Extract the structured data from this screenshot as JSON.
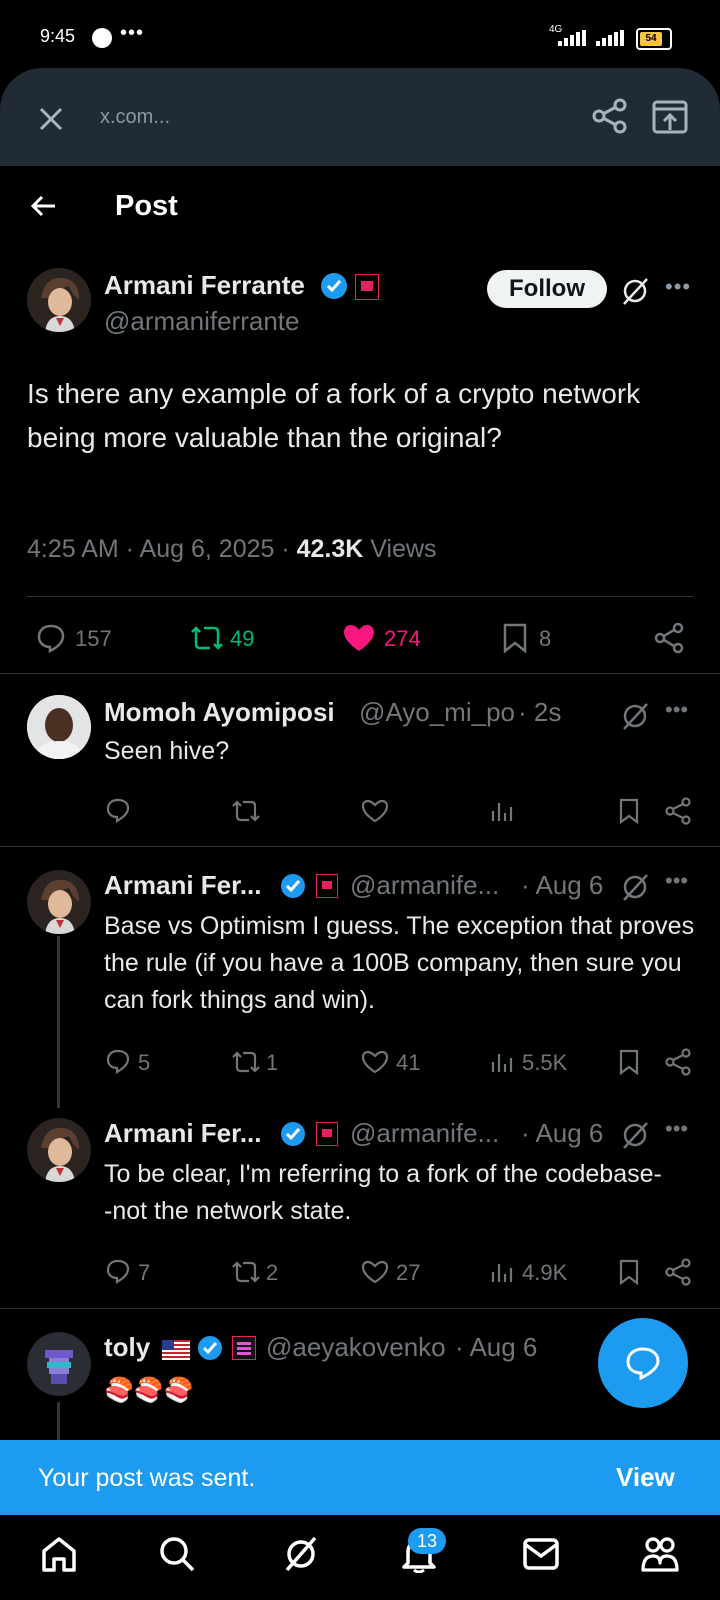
{
  "status_bar": {
    "time": "9:45",
    "network": "4G",
    "battery": "54"
  },
  "browser": {
    "url": "x.com..."
  },
  "header": {
    "title": "Post"
  },
  "post": {
    "author_name": "Armani Ferrante",
    "handle": "@armaniferrante",
    "follow_label": "Follow",
    "text": "Is there any example of a fork of a crypto network being more valuable than the original?",
    "time": "4:25 AM · Aug 6, 2025 · ",
    "views_count": "42.3K",
    "views_label": " Views",
    "stats": {
      "replies": "157",
      "reposts": "49",
      "likes": "274",
      "bookmarks": "8"
    }
  },
  "replies": [
    {
      "name": "Momoh Ayomiposi",
      "handle": "@Ayo_mi_po",
      "time": "· 2s",
      "text": "Seen hive?",
      "replies": "",
      "reposts": "",
      "likes": "",
      "views": ""
    },
    {
      "name": "Armani Fer...",
      "handle": "@armanife...",
      "time": "· Aug 6",
      "text": "Base vs Optimism I guess. The exception that proves the rule (if you have a 100B company, then sure you can fork things and win).",
      "replies": "5",
      "reposts": "1",
      "likes": "41",
      "views": "5.5K"
    },
    {
      "name": "Armani Fer...",
      "handle": "@armanife...",
      "time": "· Aug 6",
      "text": "To be clear, I'm referring to a fork of the codebase--not the network state.",
      "replies": "7",
      "reposts": "2",
      "likes": "27",
      "views": "4.9K"
    },
    {
      "name": "toly",
      "handle": "@aeyakovenko",
      "time": "· Aug 6",
      "text": "🍣🍣🍣"
    }
  ],
  "toast": {
    "message": "Your post was sent.",
    "action": "View"
  },
  "nav": {
    "notifications_badge": "13"
  },
  "colors": {
    "accent": "#1d9bf0",
    "like": "#f91880",
    "repost": "#00ba7c",
    "muted": "#71767b",
    "verified": "#1d9bf0"
  }
}
